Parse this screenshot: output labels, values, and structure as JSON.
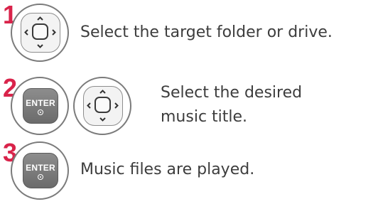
{
  "steps": [
    {
      "number": "1",
      "text": "Select the target folder or drive."
    },
    {
      "number": "2",
      "button_label": "ENTER",
      "text_line1": "Select the desired",
      "text_line2": "music title."
    },
    {
      "number": "3",
      "button_label": "ENTER",
      "text": "Music files are played."
    }
  ],
  "colors": {
    "step_number": "#d9234a",
    "text": "#3d3d3d",
    "ring": "#7b7b7b",
    "enter_button": "#7a7a7a"
  },
  "icons": [
    "navigation-pad-icon",
    "enter-button-icon"
  ]
}
